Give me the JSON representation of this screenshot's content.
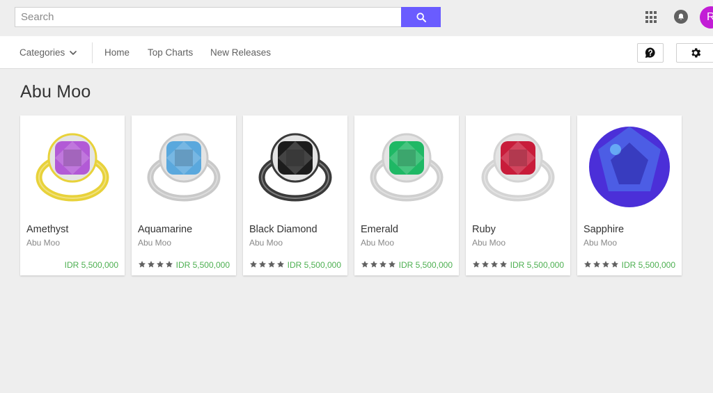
{
  "search": {
    "placeholder": "Search",
    "value": ""
  },
  "header": {
    "avatar_initial": "R",
    "avatar_color": "#c21dd6",
    "accent_color": "#6a5cff"
  },
  "nav": {
    "categories_label": "Categories",
    "links": [
      "Home",
      "Top Charts",
      "New Releases"
    ]
  },
  "icons": {
    "search": "search-icon",
    "apps": "apps-grid-icon",
    "notifications": "bell-icon",
    "help": "help-icon",
    "settings": "gear-icon"
  },
  "page": {
    "title": "Abu Moo"
  },
  "products": [
    {
      "name": "Amethyst",
      "developer": "Abu Moo",
      "price": "IDR 5,500,000",
      "stars": 0,
      "gem_color": "#b25ad6",
      "band_color": "#e8d23a"
    },
    {
      "name": "Aquamarine",
      "developer": "Abu Moo",
      "price": "IDR 5,500,000",
      "stars": 4,
      "gem_color": "#5aa8dd",
      "band_color": "#c9c9c9"
    },
    {
      "name": "Black Diamond",
      "developer": "Abu Moo",
      "price": "IDR 5,500,000",
      "stars": 4,
      "gem_color": "#1c1c1c",
      "band_color": "#3a3a3a"
    },
    {
      "name": "Emerald",
      "developer": "Abu Moo",
      "price": "IDR 5,500,000",
      "stars": 4,
      "gem_color": "#1fb865",
      "band_color": "#cfcfcf"
    },
    {
      "name": "Ruby",
      "developer": "Abu Moo",
      "price": "IDR 5,500,000",
      "stars": 4,
      "gem_color": "#c81c3a",
      "band_color": "#d4d4d4"
    },
    {
      "name": "Sapphire",
      "developer": "Abu Moo",
      "price": "IDR 5,500,000",
      "stars": 4,
      "gem_color": "#4b2fd8",
      "band_color": "none"
    }
  ]
}
